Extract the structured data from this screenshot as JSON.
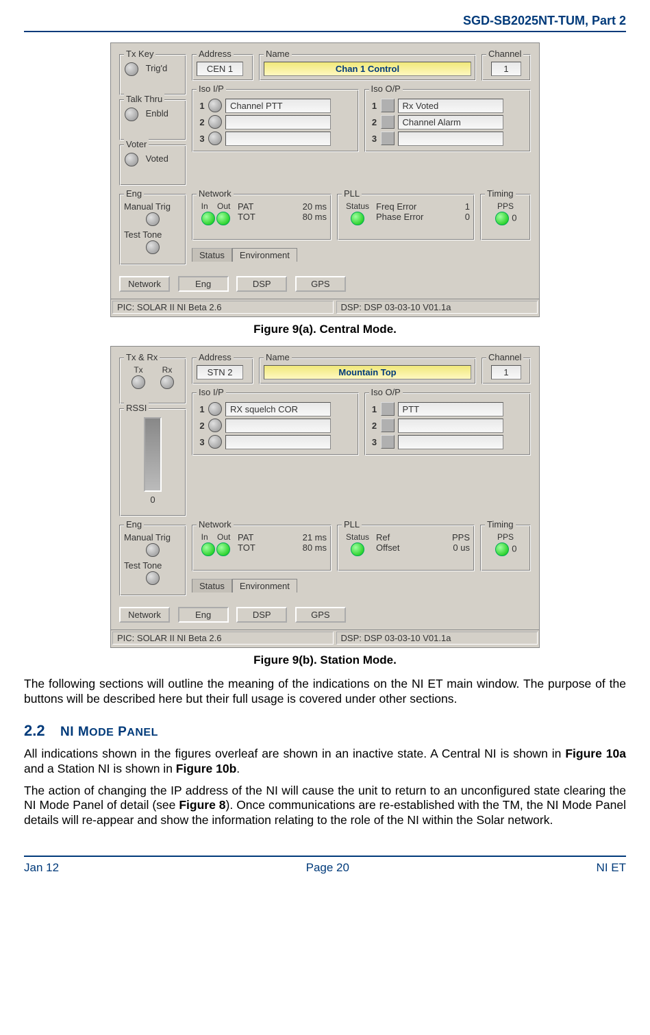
{
  "doc": {
    "header": "SGD-SB2025NT-TUM, Part 2",
    "footer_left": "Jan 12",
    "footer_center": "Page 20",
    "footer_right": "NI ET"
  },
  "caption_a": "Figure 9(a).  Central Mode.",
  "caption_b": "Figure 9(b).  Station Mode.",
  "para1": "The following sections will outline the meaning of the indications on the NI ET main window.  The purpose of the buttons will be described here but their full usage is covered under other sections.",
  "section": {
    "num": "2.2",
    "title": "NI Mode Panel"
  },
  "para2a": "All indications shown in the figures overleaf are shown in an inactive state.  A Central NI is shown in ",
  "para2b": "Figure 10a",
  "para2c": " and a Station NI is shown in ",
  "para2d": "Figure 10b",
  "para2e": ".",
  "para3a": "The action of changing the IP address of the NI will cause the unit to return to an unconfigured state clearing the NI Mode Panel of detail (see ",
  "para3b": "Figure 8",
  "para3c": ").  Once communications are re-established with the TM, the NI Mode Panel details will re-appear and show the information relating to the role of the NI within the Solar network.",
  "figA": {
    "left": {
      "txkey": {
        "title": "Tx Key",
        "label": "Trig'd"
      },
      "talkthru": {
        "title": "Talk Thru",
        "label": "Enbld"
      },
      "voter": {
        "title": "Voter",
        "label": "Voted"
      },
      "eng": {
        "title": "Eng",
        "mt": "Manual Trig",
        "tt": "Test Tone"
      }
    },
    "address": {
      "title": "Address",
      "value": "CEN 1"
    },
    "name": {
      "title": "Name",
      "value": "Chan 1 Control"
    },
    "channel": {
      "title": "Channel",
      "value": "1"
    },
    "isoip": {
      "title": "Iso I/P",
      "r1": "Channel PTT",
      "r2": "",
      "r3": "",
      "n1": "1",
      "n2": "2",
      "n3": "3"
    },
    "isoop": {
      "title": "Iso O/P",
      "r1": "Rx Voted",
      "r2": "Channel Alarm",
      "r3": "",
      "n1": "1",
      "n2": "2",
      "n3": "3"
    },
    "network": {
      "title": "Network",
      "in": "In",
      "out": "Out",
      "pat": "PAT",
      "patv": "20 ms",
      "tot": "TOT",
      "totv": "80 ms"
    },
    "pll": {
      "title": "PLL",
      "status": "Status",
      "l1": "Freq Error",
      "v1": "1",
      "l2": "Phase Error",
      "v2": "0"
    },
    "timing": {
      "title": "Timing",
      "pps": "PPS",
      "val": "0"
    },
    "tabs": {
      "status": "Status",
      "env": "Environment"
    },
    "btns": {
      "network": "Network",
      "eng": "Eng",
      "dsp": "DSP",
      "gps": "GPS"
    },
    "status_l": "PIC: SOLAR II NI Beta 2.6",
    "status_r": "DSP: DSP 03-03-10 V01.1a"
  },
  "figB": {
    "left": {
      "txrx": {
        "title": "Tx & Rx",
        "tx": "Tx",
        "rx": "Rx"
      },
      "rssi": {
        "title": "RSSI",
        "val": "0"
      },
      "eng": {
        "title": "Eng",
        "mt": "Manual Trig",
        "tt": "Test Tone"
      }
    },
    "address": {
      "title": "Address",
      "value": "STN 2"
    },
    "name": {
      "title": "Name",
      "value": "Mountain Top"
    },
    "channel": {
      "title": "Channel",
      "value": "1"
    },
    "isoip": {
      "title": "Iso I/P",
      "r1": "RX squelch COR",
      "r2": "",
      "r3": "",
      "n1": "1",
      "n2": "2",
      "n3": "3"
    },
    "isoop": {
      "title": "Iso O/P",
      "r1": "PTT",
      "r2": "",
      "r3": "",
      "n1": "1",
      "n2": "2",
      "n3": "3"
    },
    "network": {
      "title": "Network",
      "in": "In",
      "out": "Out",
      "pat": "PAT",
      "patv": "21 ms",
      "tot": "TOT",
      "totv": "80 ms"
    },
    "pll": {
      "title": "PLL",
      "status": "Status",
      "l1": "Ref",
      "v1": "PPS",
      "l2": "Offset",
      "v2": "0 us"
    },
    "timing": {
      "title": "Timing",
      "pps": "PPS",
      "val": "0"
    },
    "tabs": {
      "status": "Status",
      "env": "Environment"
    },
    "btns": {
      "network": "Network",
      "eng": "Eng",
      "dsp": "DSP",
      "gps": "GPS"
    },
    "status_l": "PIC: SOLAR II NI Beta 2.6",
    "status_r": "DSP: DSP 03-03-10 V01.1a"
  }
}
